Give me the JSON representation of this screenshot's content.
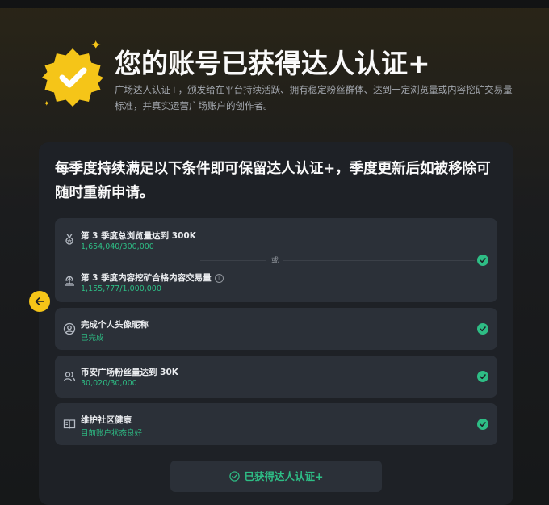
{
  "hero": {
    "title": "您的账号已获得达人认证+",
    "description": "广场达人认证+，颁发给在平台持续活跃、拥有稳定粉丝群体、达到一定浏览量或内容挖矿交易量标准，并真实运营广场账户的创作者。"
  },
  "card": {
    "heading": "每季度持续满足以下条件即可保留达人认证+，季度更新后如被移除可随时重新申请。",
    "requirements": [
      {
        "title": "第 3 季度总浏览量达到 300K",
        "progress": "1,654,040/300,000",
        "icon": "medal-icon"
      },
      {
        "title": "第 3 季度内容挖矿合格内容交易量",
        "progress": "1,155,777/1,000,000",
        "icon": "mining-icon"
      },
      {
        "title": "完成个人头像昵称",
        "progress": "已完成",
        "icon": "user-circle-icon"
      },
      {
        "title": "币安广场粉丝量达到 30K",
        "progress": "30,020/30,000",
        "icon": "users-icon"
      },
      {
        "title": "维护社区健康",
        "progress": "目前账户状态良好",
        "icon": "book-icon"
      }
    ],
    "or_label": "或"
  },
  "cta": {
    "label": "已获得达人认证+"
  },
  "colors": {
    "accent": "#f5c518",
    "success": "#2ebd85",
    "card": "#1e2126",
    "row": "#2b3038"
  }
}
